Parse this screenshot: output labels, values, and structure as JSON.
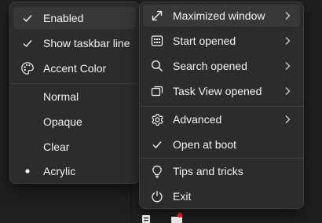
{
  "left_menu": {
    "items": [
      {
        "label": "Enabled",
        "icon": "checkmark-icon",
        "checked": true
      },
      {
        "label": "Show taskbar line",
        "icon": "checkmark-icon",
        "checked": true
      },
      {
        "label": "Accent Color",
        "icon": "palette-icon"
      }
    ],
    "styles": [
      {
        "label": "Normal"
      },
      {
        "label": "Opaque"
      },
      {
        "label": "Clear"
      },
      {
        "label": "Acrylic",
        "selected": true
      }
    ]
  },
  "right_menu": {
    "items": [
      {
        "label": "Maximized window",
        "icon": "resize-diagonal-icon",
        "submenu": true
      },
      {
        "label": "Start opened",
        "icon": "start-grid-icon",
        "submenu": true
      },
      {
        "label": "Search opened",
        "icon": "search-icon",
        "submenu": true
      },
      {
        "label": "Task View opened",
        "icon": "task-view-icon",
        "submenu": true
      },
      {
        "label": "Advanced",
        "icon": "gear-icon",
        "submenu": true
      },
      {
        "label": "Open at boot",
        "icon": "checkmark-icon",
        "checked": true
      },
      {
        "label": "Tips and tricks",
        "icon": "lightbulb-icon"
      },
      {
        "label": "Exit",
        "icon": "power-icon"
      }
    ]
  },
  "colors": {
    "background": "#202020",
    "menu_background": "#2c2c2c",
    "hover": "#383838",
    "text": "#f2f2f2",
    "taskbar_badge": "#e81123"
  }
}
